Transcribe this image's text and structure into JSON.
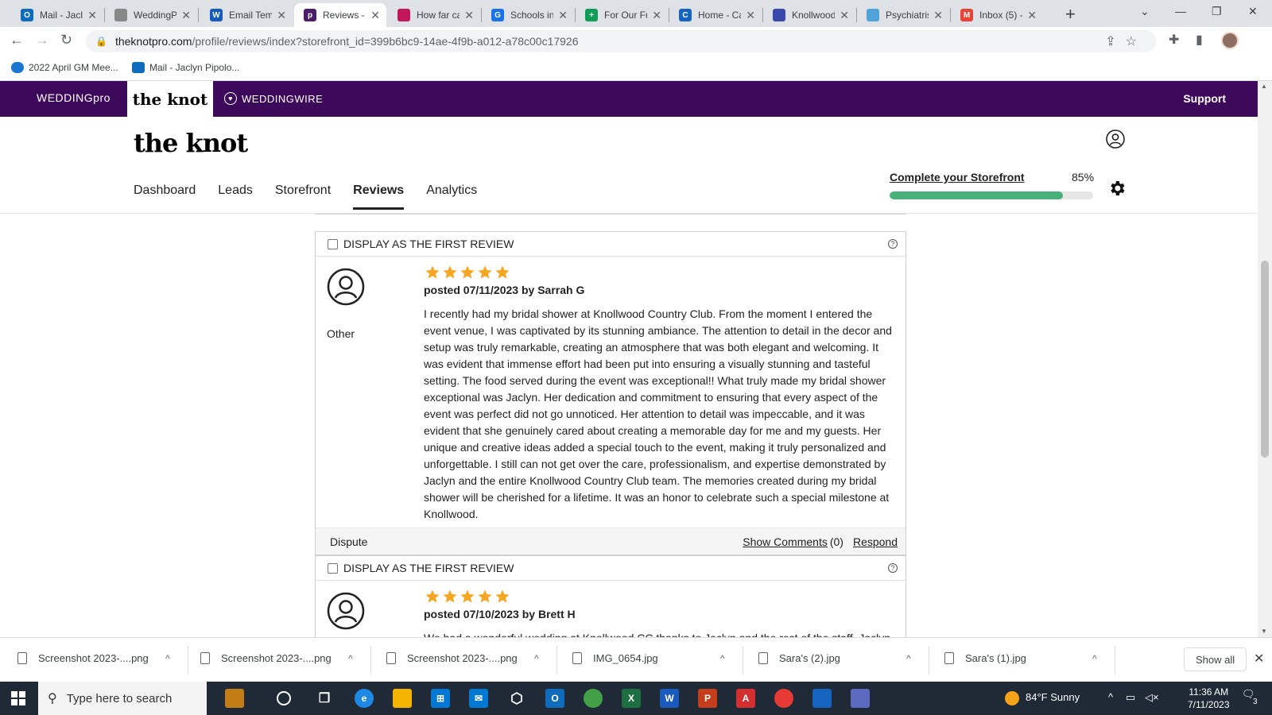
{
  "browser": {
    "tabs": [
      {
        "label": "Mail - Jacl",
        "color": "#0f6cbd",
        "glyph": "O"
      },
      {
        "label": "WeddingP",
        "color": "#888888",
        "glyph": ""
      },
      {
        "label": "Email Tem",
        "color": "#185abd",
        "glyph": "W"
      },
      {
        "label": "Reviews -",
        "color": "#4b1d6b",
        "glyph": "p"
      },
      {
        "label": "How far ca",
        "color": "#c2185b",
        "glyph": ""
      },
      {
        "label": "Schools in",
        "color": "#1a73e8",
        "glyph": "G"
      },
      {
        "label": "For Our Fu",
        "color": "#0f9d58",
        "glyph": "+"
      },
      {
        "label": "Home - Ca",
        "color": "#1565c0",
        "glyph": "C"
      },
      {
        "label": "Knollwood",
        "color": "#3949ab",
        "glyph": ""
      },
      {
        "label": "Psychiatris",
        "color": "#4fa3d9",
        "glyph": ""
      },
      {
        "label": "Inbox (5) -",
        "color": "#ea4335",
        "glyph": "M"
      }
    ],
    "url_host": "theknotpro.com",
    "url_path": "/profile/reviews/index?storefront_id=399b6bc9-14ae-4f9b-a012-a78c00c17926",
    "bookmarks": [
      "2022 April GM Mee...",
      "Mail - Jaclyn Pipolo..."
    ]
  },
  "site": {
    "wedding_pro": "WEDDINGpro",
    "knot_tab": "the knot",
    "weddingwire": "WEDDINGWIRE",
    "support": "Support",
    "logo": "the knot",
    "nav": [
      "Dashboard",
      "Leads",
      "Storefront",
      "Reviews",
      "Analytics"
    ],
    "active_nav": "Reviews",
    "complete_label": "Complete your Storefront",
    "complete_pct": "85%",
    "complete_value": 0.85
  },
  "reviews": [
    {
      "display_first": "DISPLAY AS THE FIRST REVIEW",
      "role": "Other",
      "rating": 5,
      "posted": "posted 07/11/2023 by Sarrah G",
      "text": "I recently had my bridal shower at Knollwood Country Club. From the moment I entered the event venue, I was captivated by its stunning ambiance. The attention to detail in the decor and setup was truly remarkable, creating an atmosphere that was both elegant and welcoming. It was evident that immense effort had been put into ensuring a visually stunning and tasteful setting. The food served during the event was exceptional!! What truly made my bridal shower exceptional was Jaclyn. Her dedication and commitment to ensuring that every aspect of the event was perfect did not go unnoticed. Her attention to detail was impeccable, and it was evident that she genuinely cared about creating a memorable day for me and my guests. Her unique and creative ideas added a special touch to the event, making it truly personalized and unforgettable. I still can not get over the care, professionalism, and expertise demonstrated by Jaclyn and the entire Knollwood Country Club team. The memories created during my bridal shower will be cherished for a lifetime. It was an honor to celebrate such a special milestone at Knollwood.",
      "dispute": "Dispute",
      "show_comments": "Show Comments",
      "comment_count": "(0)",
      "respond": "Respond"
    },
    {
      "display_first": "DISPLAY AS THE FIRST REVIEW",
      "role": "",
      "rating": 5,
      "posted": "posted 07/10/2023 by Brett H",
      "text": "We had a wonderful wedding at Knollwood CC thanks to Jaclyn and the rest of the staff. Jaclyn"
    }
  ],
  "downloads": {
    "items": [
      "Screenshot 2023-....png",
      "Screenshot 2023-....png",
      "Screenshot 2023-....png",
      "IMG_0654.jpg",
      "Sara's (2).jpg",
      "Sara's (1).jpg"
    ],
    "show_all": "Show all"
  },
  "taskbar": {
    "search_placeholder": "Type here to search",
    "weather": "84°F  Sunny",
    "time": "11:36 AM",
    "date": "7/11/2023",
    "notifications": "3"
  },
  "colors": {
    "site_bar": "#3d0a5b",
    "progress": "#46b178",
    "star": "#f5a623"
  }
}
